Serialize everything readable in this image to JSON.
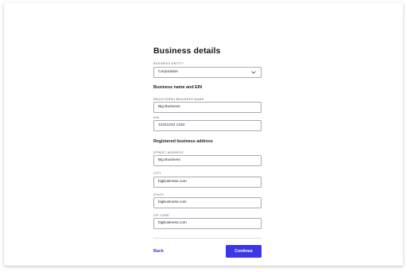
{
  "page": {
    "title": "Business details",
    "entity": {
      "label": "BUSINESS ENTITY",
      "value": "Corporation"
    },
    "name_section": {
      "heading": "Business name and EIN",
      "name_label": "REGISTERED BUSINESS NAME",
      "name_value": "Big Business",
      "ein_label": "EIN",
      "ein_value": "12341234 1234"
    },
    "address_section": {
      "heading": "Registered business address",
      "street_label": "STREET ADDRESS",
      "street_value": "Big Business",
      "city_label": "CITY",
      "city_value": "bigbusiness.com",
      "state_label": "STATE",
      "state_value": "bigbusiness.com",
      "zip_label": "ZIP CODE",
      "zip_value": "bigbusiness.com"
    },
    "actions": {
      "back_label": "Back",
      "continue_label": "Continue"
    },
    "colors": {
      "accent": "#3b37e6",
      "link": "#3d3ade",
      "border": "#a9a9b2"
    },
    "icons": {
      "entity_dropdown": "chevron-down-icon"
    }
  }
}
